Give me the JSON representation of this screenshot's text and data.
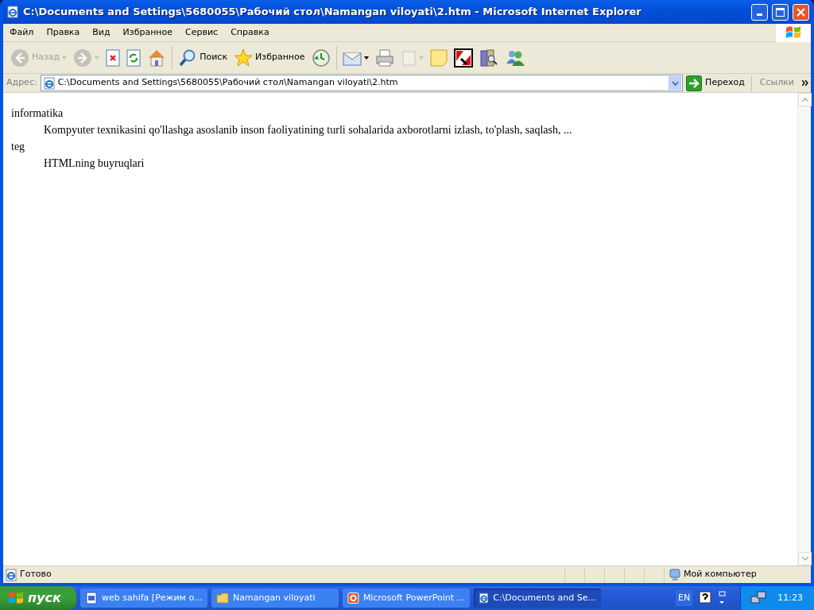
{
  "window": {
    "title": "C:\\Documents and Settings\\5680055\\Рабочий стол\\Namangan viloyati\\2.htm - Microsoft Internet Explorer"
  },
  "menu": [
    "Файл",
    "Правка",
    "Вид",
    "Избранное",
    "Сервис",
    "Справка"
  ],
  "toolbar": [
    {
      "kind": "back",
      "label": "Назад",
      "disabled": true,
      "dropdown": true
    },
    {
      "kind": "forward",
      "disabled": true,
      "dropdown": true
    },
    {
      "kind": "stop",
      "disabled": false
    },
    {
      "kind": "refresh",
      "disabled": false
    },
    {
      "kind": "home",
      "disabled": false
    },
    {
      "kind": "search",
      "label": "Поиск",
      "disabled": false
    },
    {
      "kind": "favorites",
      "label": "Избранное",
      "disabled": false
    },
    {
      "kind": "history",
      "disabled": false
    },
    {
      "kind": "mail",
      "disabled": false,
      "dropdown": true
    },
    {
      "kind": "print",
      "disabled": false
    },
    {
      "kind": "word",
      "disabled": true,
      "dropdown": true
    },
    {
      "kind": "note",
      "disabled": false
    },
    {
      "kind": "antivirus",
      "disabled": false
    },
    {
      "kind": "research",
      "disabled": false
    },
    {
      "kind": "messenger",
      "disabled": false
    }
  ],
  "address": {
    "label": "Адрес:",
    "value": "C:\\Documents and Settings\\5680055\\Рабочий стол\\Namangan viloyati\\2.htm",
    "go": "Переход",
    "links": "Ссылки"
  },
  "content": [
    {
      "term": "informatika",
      "definition": "Kompyuter texnikasini qo'llashga asoslanib inson faoliyatining turli sohalarida axborotlarni izlash, to'plash, saqlash, ..."
    },
    {
      "term": "teg",
      "definition": "HTMLning buyruqlari"
    }
  ],
  "status_bar": {
    "text": "Готово",
    "zone": "Мой компьютер"
  },
  "taskbar": {
    "start": "пуск",
    "tasks": [
      {
        "kind": "word",
        "label": "web sahifa [Режим о...",
        "selected": false
      },
      {
        "kind": "folder",
        "label": "Namangan viloyati",
        "selected": false
      },
      {
        "kind": "powerpoint",
        "label": "Microsoft PowerPoint ...",
        "selected": false
      },
      {
        "kind": "ie",
        "label": "C:\\Documents and Se...",
        "selected": true
      }
    ],
    "language": "EN",
    "clock": "11:23"
  }
}
